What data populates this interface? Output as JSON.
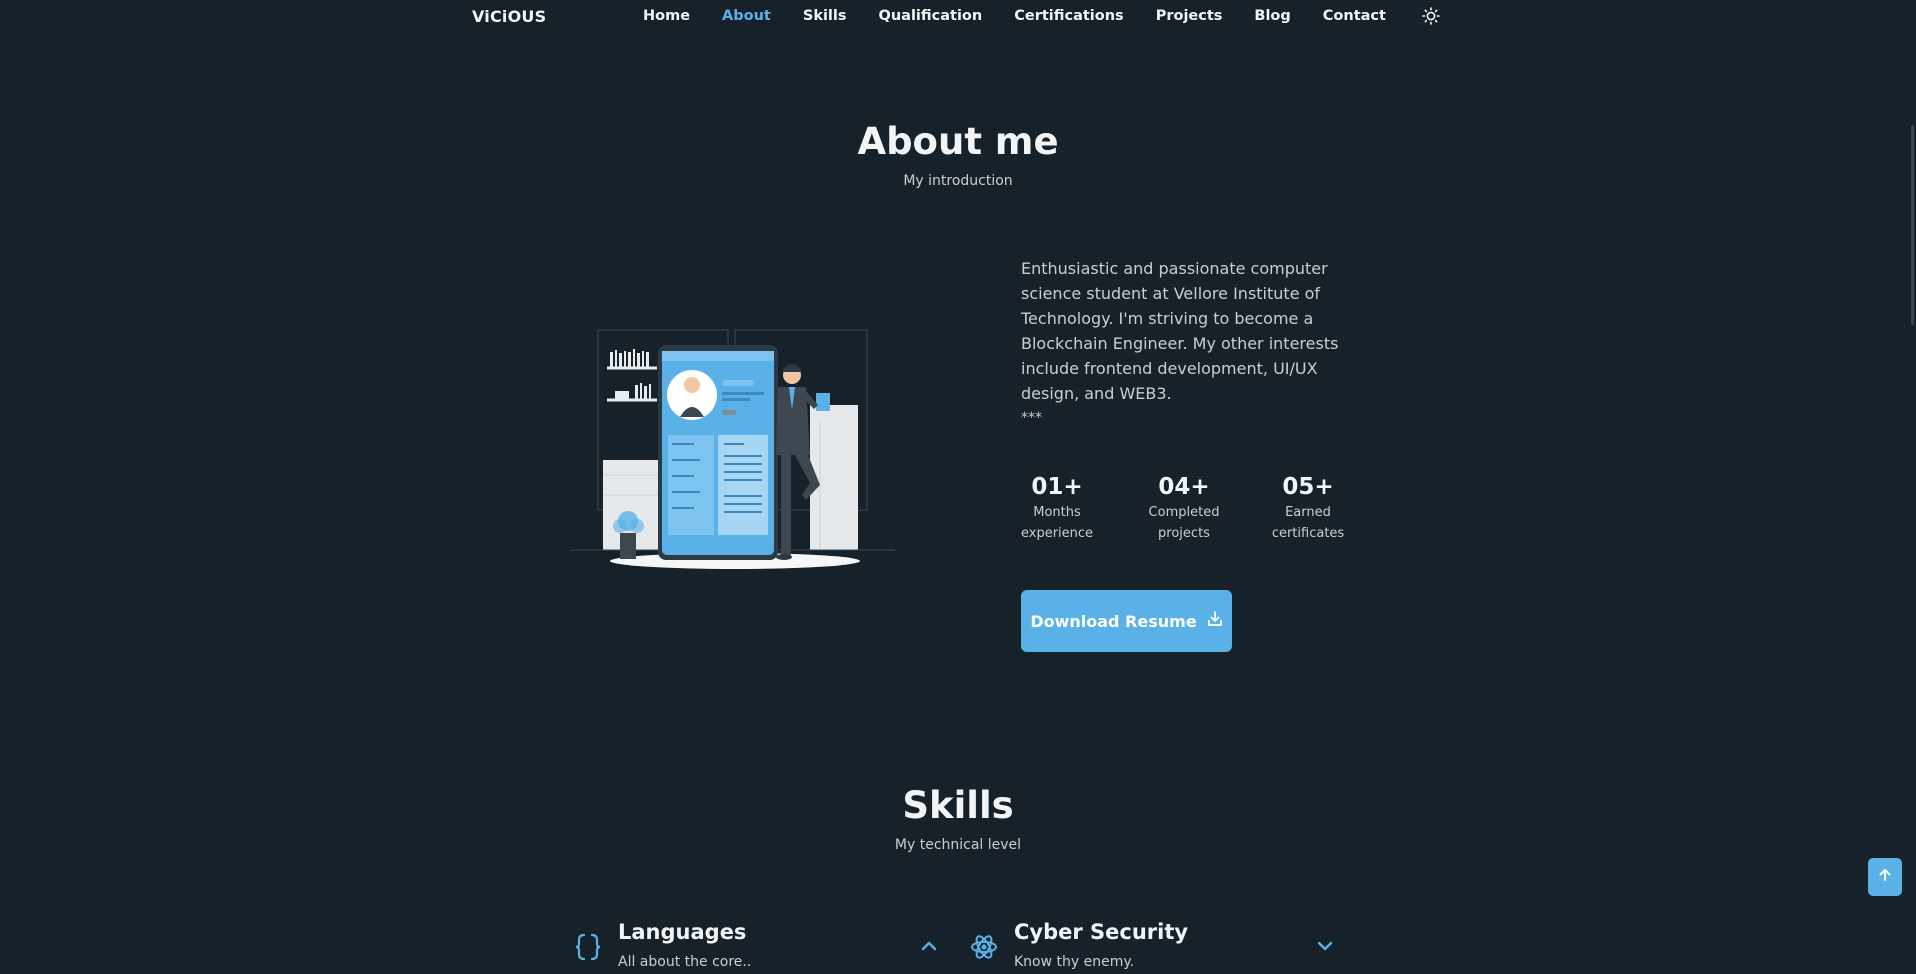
{
  "nav": {
    "logo": "ViCiOUS",
    "items": [
      {
        "label": "Home",
        "active": false
      },
      {
        "label": "About",
        "active": true
      },
      {
        "label": "Skills",
        "active": false
      },
      {
        "label": "Qualification",
        "active": false
      },
      {
        "label": "Certifications",
        "active": false
      },
      {
        "label": "Projects",
        "active": false
      },
      {
        "label": "Blog",
        "active": false
      },
      {
        "label": "Contact",
        "active": false
      }
    ],
    "theme_icon": "sun-icon"
  },
  "about": {
    "title": "About me",
    "subtitle": "My introduction",
    "description": "Enthusiastic and passionate computer science student at Vellore Institute of Technology. I'm striving to become a Blockchain Engineer. My other interests include frontend development, UI/UX design, and WEB3.",
    "stars": "***",
    "stats": [
      {
        "number": "01+",
        "line1": "Months",
        "line2": "experience"
      },
      {
        "number": "04+",
        "line1": "Completed",
        "line2": "projects"
      },
      {
        "number": "05+",
        "line1": "Earned",
        "line2": "certificates"
      }
    ],
    "resume_label": "Download Resume",
    "resume_icon": "download-icon"
  },
  "skills": {
    "title": "Skills",
    "subtitle": "My technical level",
    "cards": [
      {
        "title": "Languages",
        "subtitle": "All about the core..",
        "icon": "braces-icon",
        "expanded": true
      },
      {
        "title": "Cyber Security",
        "subtitle": "Know thy enemy.",
        "icon": "atom-icon",
        "expanded": false
      }
    ]
  },
  "colors": {
    "background": "#17212a",
    "accent": "#5ab1e8",
    "text": "#f2f4f5",
    "muted": "#c9ced3"
  }
}
